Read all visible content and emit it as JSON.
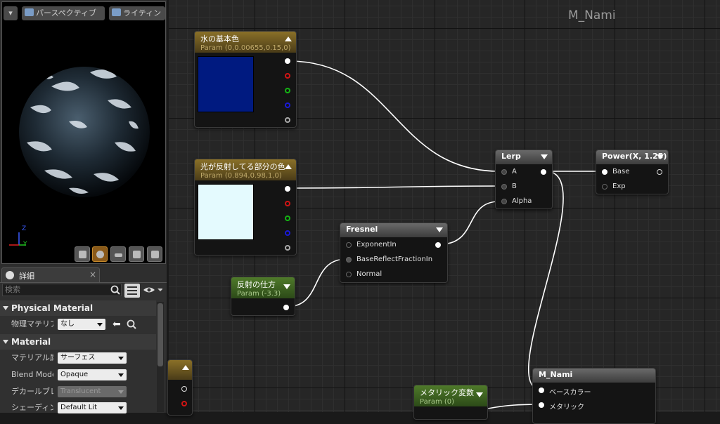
{
  "viewport": {
    "dropdown_glyph": "▾",
    "view_mode_label": "パースペクティブ",
    "lighting_label": "ライティン",
    "axis_z": "Z",
    "axis_y": "Y"
  },
  "details": {
    "tab_label": "詳細",
    "tab_close": "×",
    "search_placeholder": "検索",
    "sections": {
      "physical": {
        "title": "Physical Material",
        "prop_label": "物理マテリア",
        "prop_value": "なし"
      },
      "material": {
        "title": "Material",
        "rows": [
          {
            "label": "マテリアル属",
            "value": "サーフェス"
          },
          {
            "label": "Blend Mode",
            "value": "Opaque"
          },
          {
            "label": "デカールブレ",
            "value": "Translucent"
          },
          {
            "label": "シェーディン",
            "value": "Default Lit"
          }
        ]
      }
    }
  },
  "graph": {
    "title": "M_Nami",
    "nodes": {
      "water_color": {
        "title": "水の基本色",
        "subtitle": "Param (0,0.00655,0.15,0)",
        "color": "#001a80"
      },
      "reflect_color": {
        "title": "光が反射してる部分の色",
        "subtitle": "Param (0.894,0.98,1,0)",
        "color": "#e4fafe"
      },
      "reflect_way": {
        "title": "反射の仕方",
        "subtitle": "Param (-3.3)"
      },
      "fresnel": {
        "title": "Fresnel",
        "inputs": [
          "ExponentIn",
          "BaseReflectFractionIn",
          "Normal"
        ]
      },
      "lerp": {
        "title": "Lerp",
        "inputs": [
          "A",
          "B",
          "Alpha"
        ]
      },
      "power": {
        "title": "Power(X, 1.25)",
        "inputs": [
          "Base",
          "Exp"
        ]
      },
      "metallic": {
        "title": "メタリック変数",
        "subtitle": "Param (0)"
      },
      "result": {
        "title": "M_Nami",
        "inputs": [
          "ベースカラー",
          "メタリック"
        ]
      }
    }
  }
}
